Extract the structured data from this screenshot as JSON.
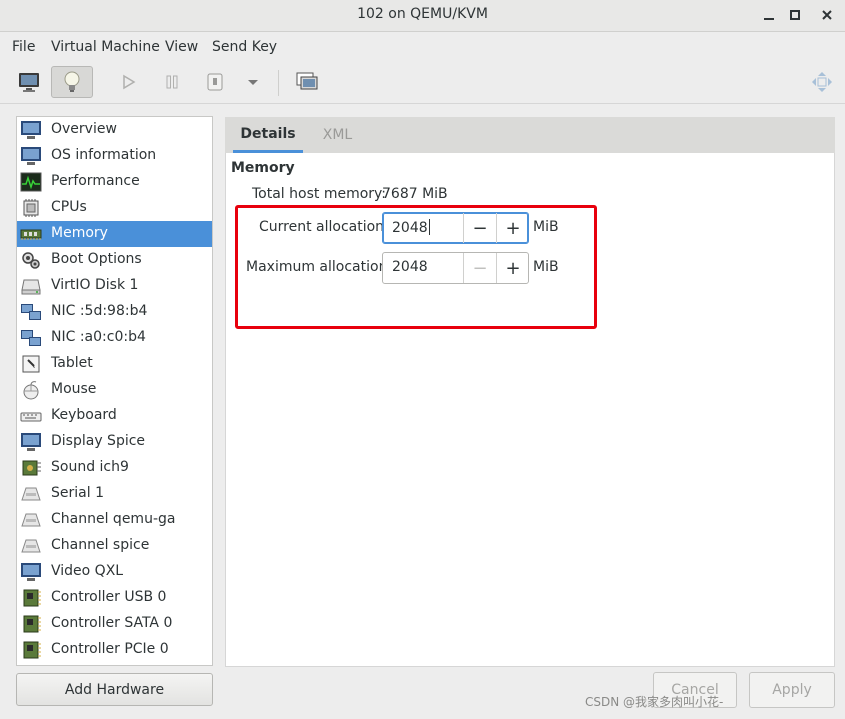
{
  "window": {
    "title": "102 on QEMU/KVM"
  },
  "menubar": {
    "items": [
      "File",
      "Virtual Machine",
      "View",
      "Send Key"
    ]
  },
  "toolbar": {
    "icons": [
      "monitor-icon",
      "lightbulb-icon",
      "play-icon",
      "pause-icon",
      "power-icon",
      "dropdown-arrow-icon",
      "snapshots-icon",
      "fullscreen-icon"
    ]
  },
  "sidebar": {
    "items": [
      {
        "label": "Overview",
        "icon": "monitor-icon"
      },
      {
        "label": "OS information",
        "icon": "monitor-icon"
      },
      {
        "label": "Performance",
        "icon": "performance-icon"
      },
      {
        "label": "CPUs",
        "icon": "cpu-icon"
      },
      {
        "label": "Memory",
        "icon": "memory-icon"
      },
      {
        "label": "Boot Options",
        "icon": "gear-icon"
      },
      {
        "label": "VirtIO Disk 1",
        "icon": "disk-icon"
      },
      {
        "label": "NIC :5d:98:b4",
        "icon": "network-icon"
      },
      {
        "label": "NIC :a0:c0:b4",
        "icon": "network-icon"
      },
      {
        "label": "Tablet",
        "icon": "tablet-icon"
      },
      {
        "label": "Mouse",
        "icon": "mouse-icon"
      },
      {
        "label": "Keyboard",
        "icon": "keyboard-icon"
      },
      {
        "label": "Display Spice",
        "icon": "monitor-icon"
      },
      {
        "label": "Sound ich9",
        "icon": "sound-icon"
      },
      {
        "label": "Serial 1",
        "icon": "serial-icon"
      },
      {
        "label": "Channel qemu-ga",
        "icon": "serial-icon"
      },
      {
        "label": "Channel spice",
        "icon": "serial-icon"
      },
      {
        "label": "Video QXL",
        "icon": "monitor-icon"
      },
      {
        "label": "Controller USB 0",
        "icon": "controller-icon"
      },
      {
        "label": "Controller SATA 0",
        "icon": "controller-icon"
      },
      {
        "label": "Controller PCIe 0",
        "icon": "controller-icon"
      }
    ],
    "selected": "Memory",
    "add_hardware": "Add Hardware"
  },
  "tabs": {
    "details": "Details",
    "xml": "XML"
  },
  "memory": {
    "section_title": "Memory",
    "total_label": "Total host memory:",
    "total_value": "7687 MiB",
    "current_label": "Current allocation:",
    "current_value": "2048",
    "max_label": "Maximum allocation:",
    "max_value": "2048",
    "unit": "MiB",
    "minus": "−",
    "plus": "+"
  },
  "buttons": {
    "cancel": "Cancel",
    "apply": "Apply"
  },
  "watermark": "CSDN @我家多肉叫小花-",
  "colors": {
    "accent": "#4a90d9",
    "highlight": "#e8000d"
  }
}
